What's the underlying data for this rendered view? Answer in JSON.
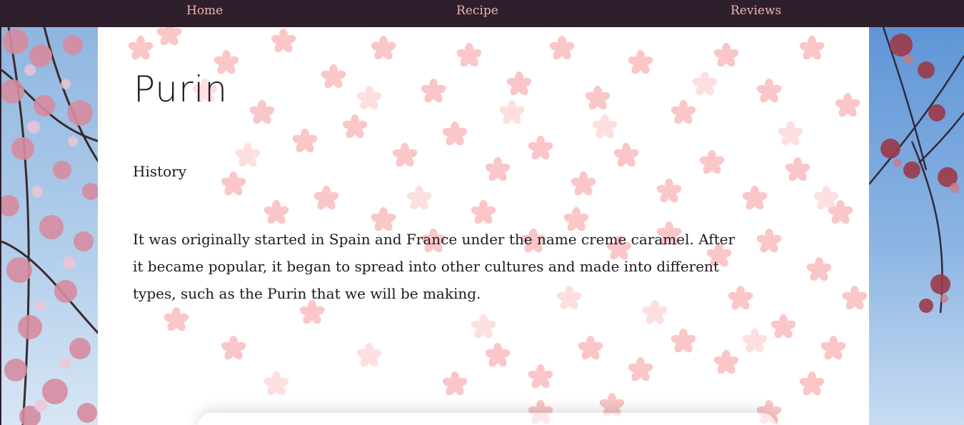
{
  "nav": {
    "items": [
      {
        "label": "Home"
      },
      {
        "label": "Recipe"
      },
      {
        "label": "Reviews"
      }
    ]
  },
  "page": {
    "title": "Purin",
    "section_heading": "History",
    "section_body": "It was originally started in Spain and France under the name creme caramel. After it became popular, it began to spread into other cultures and made into different types, such as the Purin that we will be making."
  },
  "colors": {
    "nav_background": "#2e1f2d",
    "nav_text": "#f3b3ad",
    "petal": "#f9b4b6",
    "text": "#1b1a1e"
  }
}
